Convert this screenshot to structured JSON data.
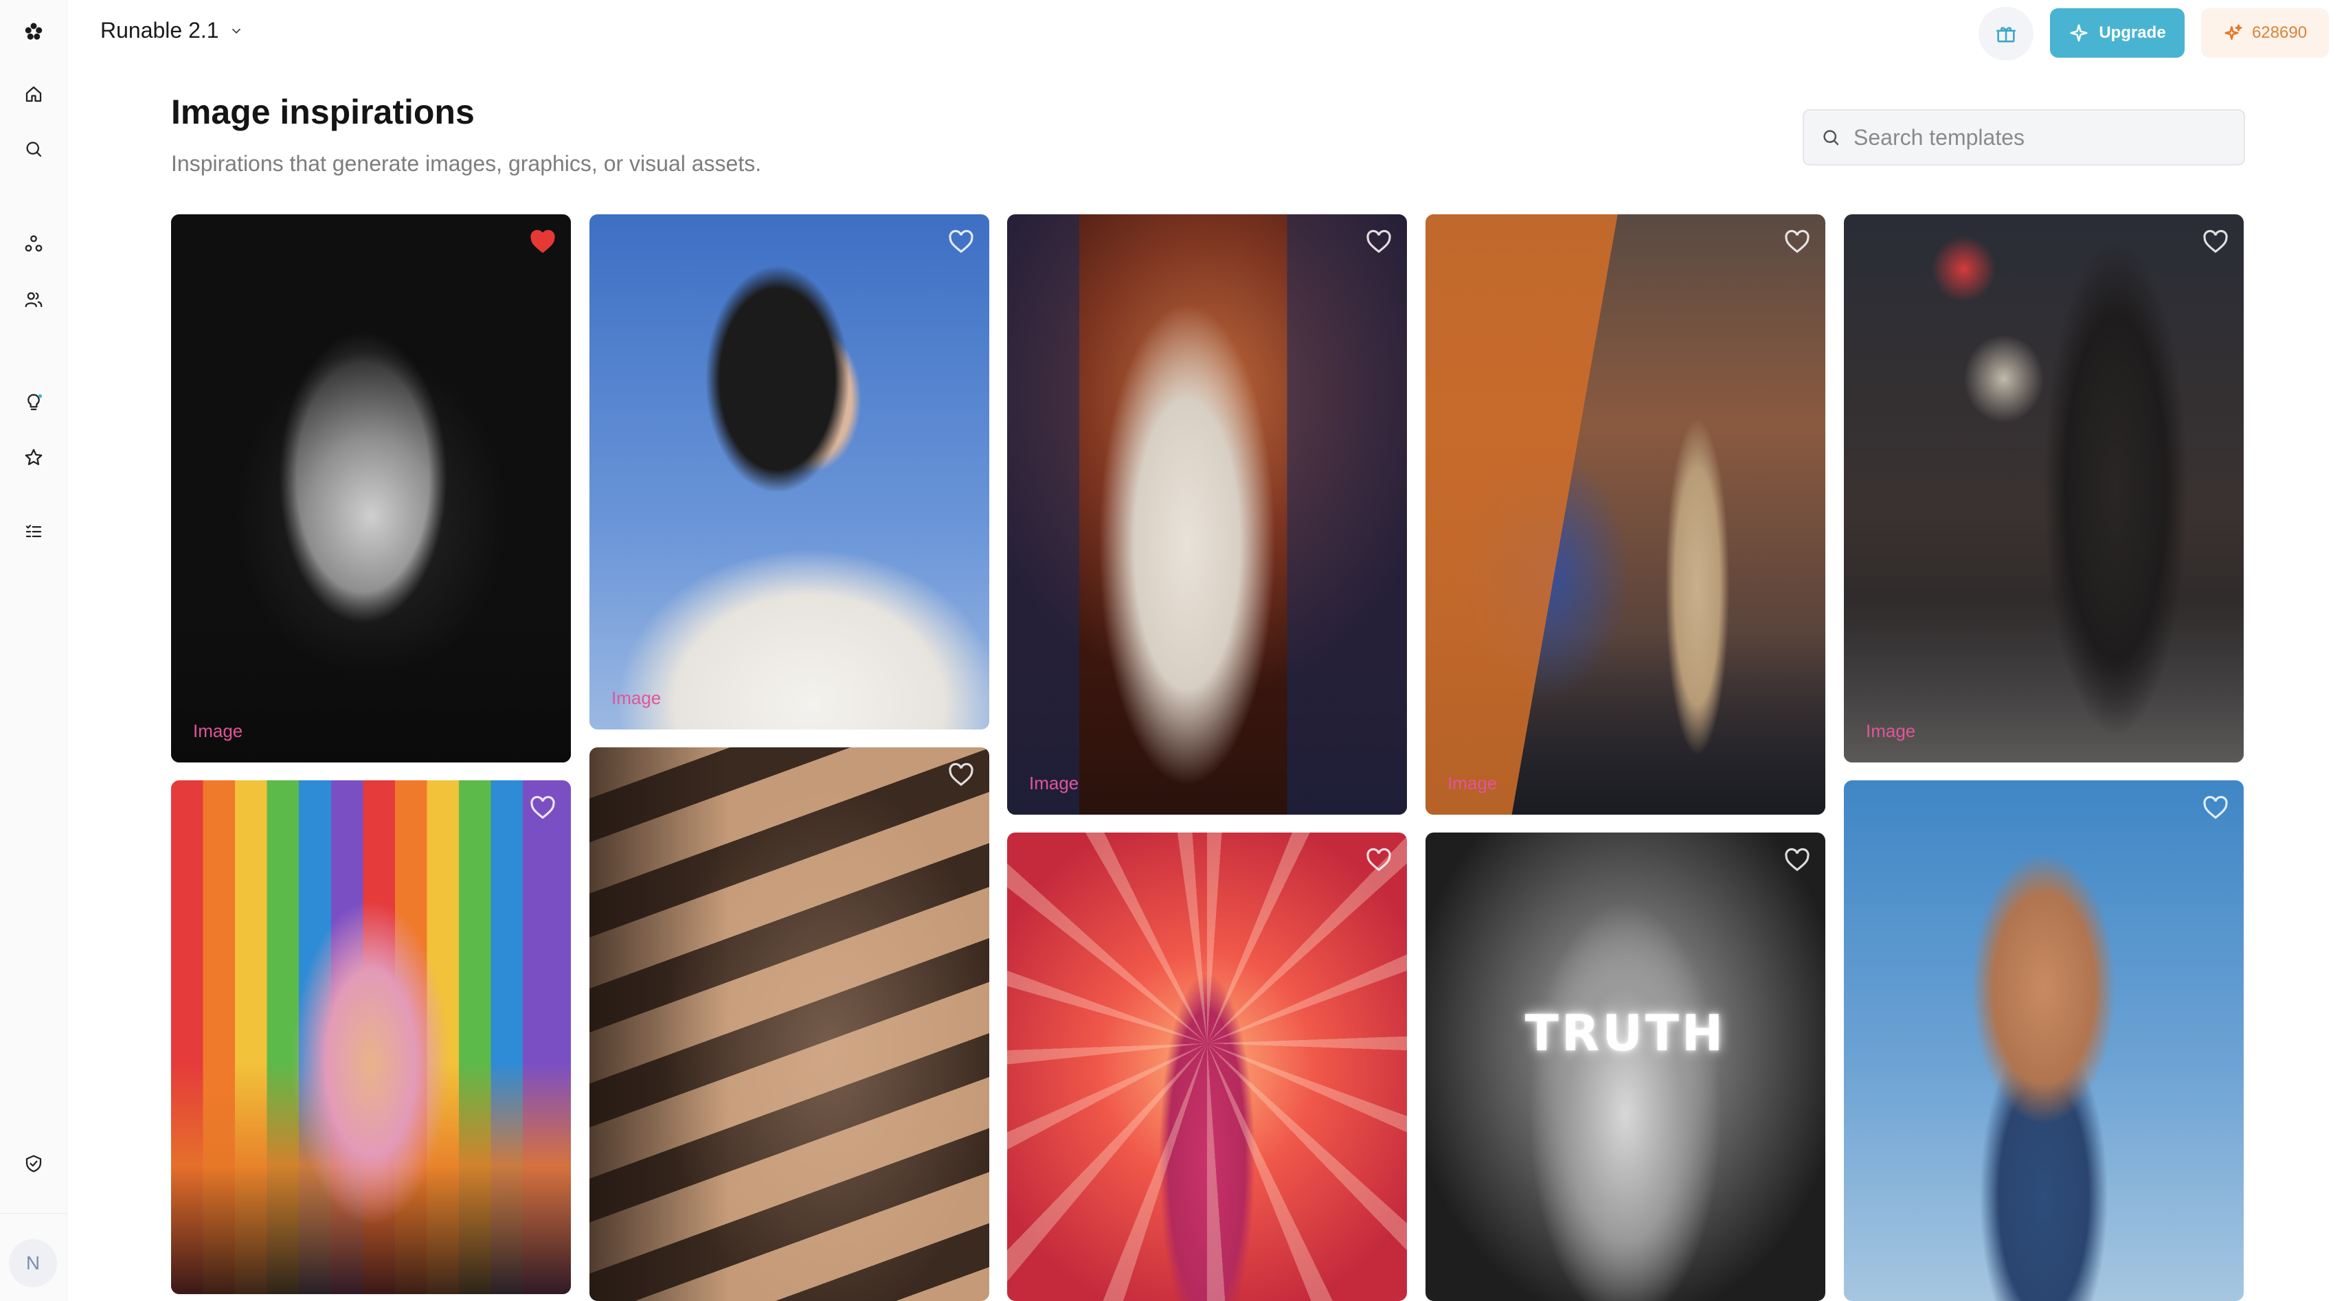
{
  "header": {
    "app_title": "Runable 2.1",
    "upgrade_label": "Upgrade",
    "credits": "628690"
  },
  "sidebar": {
    "items": [
      {
        "icon": "logo-icon"
      },
      {
        "icon": "home-icon"
      },
      {
        "icon": "search-icon"
      },
      {
        "icon": "nodes-icon"
      },
      {
        "icon": "users-icon"
      },
      {
        "icon": "lightbulb-icon"
      },
      {
        "icon": "star-icon"
      },
      {
        "icon": "list-icon"
      },
      {
        "icon": "shield-icon"
      }
    ],
    "avatar_initial": "N"
  },
  "page": {
    "title": "Image inspirations",
    "subtitle": "Inspirations that generate images, graphics, or visual assets."
  },
  "search": {
    "placeholder": "Search templates"
  },
  "cards": [
    {
      "tag": "Image",
      "liked": true
    },
    {
      "tag": "Image",
      "liked": false
    },
    {
      "tag": "Image",
      "liked": false
    },
    {
      "tag": "Image",
      "liked": false
    },
    {
      "tag": "Image",
      "liked": false
    },
    {
      "tag": "Image",
      "liked": false
    },
    {
      "tag": "",
      "liked": false
    },
    {
      "tag": "",
      "liked": false
    },
    {
      "tag": "",
      "liked": false
    },
    {
      "tag": "",
      "liked": false
    }
  ],
  "card_overlay_text": {
    "truth": "TRUTH"
  },
  "colors": {
    "accent": "#49b4d1",
    "credits_text": "#d8843a",
    "tag": "#e0559a",
    "like": "#e53935"
  }
}
